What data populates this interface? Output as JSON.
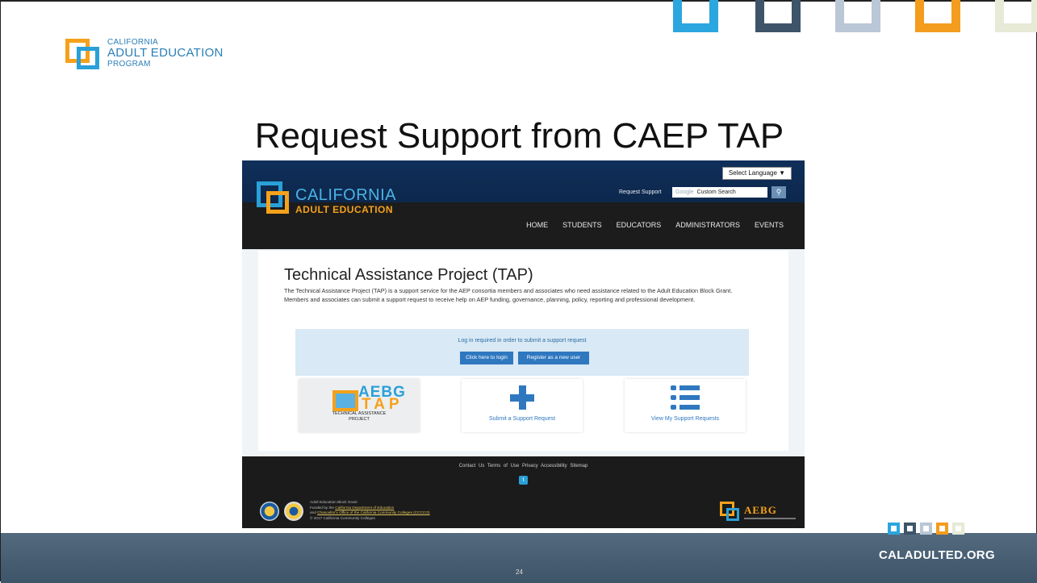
{
  "colors": {
    "brand_blue": "#2aa0d8",
    "brand_orange": "#f5a11b",
    "deco_squares": [
      "#2ba6df",
      "#3e5468",
      "#b9c7d6",
      "#f39c1e",
      "#e6ead6"
    ],
    "bottom_bar": "#46607a"
  },
  "slide": {
    "logo": {
      "line1": "CALIFORNIA",
      "line2": "ADULT EDUCATION",
      "line3": "PROGRAM"
    },
    "title": "Request Support from CAEP TAP",
    "footer_url": "CALADULTED.ORG",
    "page_number": "24"
  },
  "site": {
    "logo_line1": "CALIFORNIA",
    "logo_line2": "ADULT EDUCATION",
    "language_select": "Select Language  ▼",
    "request_support": "Request Support",
    "search_placeholder": "Google",
    "search_value": "Custom Search",
    "search_icon": "magnifier-icon",
    "nav": [
      "HOME",
      "STUDENTS",
      "EDUCATORS",
      "ADMINISTRATORS",
      "EVENTS"
    ],
    "page_heading": "Technical Assistance Project (TAP)",
    "intro": "The Technical Assistance Project (TAP) is a support service for the AEP consortia members and associates who need assistance related to the Adult Education Block Grant. Members and associates can submit a support request to receive help on AEP funding, governance, planning, policy, reporting and professional development.",
    "login_message": "Log in required in order to submit a support request",
    "login_button": "Click here to login",
    "register_button": "Register as a new user",
    "cards": {
      "tap_logo_line1": "AEBG",
      "tap_logo_line2": "TAP",
      "tap_caption_line1": "TECHNICAL ASSISTANCE",
      "tap_caption_line2": "PROJECT",
      "submit_link": "Submit a Support Request",
      "view_link": "View My Support Requests"
    },
    "footer": {
      "links": [
        "Contact Us",
        "Terms of Use",
        "Privacy",
        "Accessibility",
        "Sitemap"
      ],
      "twitter_icon": "twitter-icon",
      "text_line1": "Adult Education Block Grant",
      "text_line2_prefix": "Funded by the ",
      "text_line2_link": "California Department of Education",
      "text_line3_prefix": "and ",
      "text_line3_link": "Chancellor's Office of the California Community Colleges (CCCCO)",
      "text_line4": "© 2017 California Community Colleges",
      "aebg_logo": "AEBG"
    }
  }
}
